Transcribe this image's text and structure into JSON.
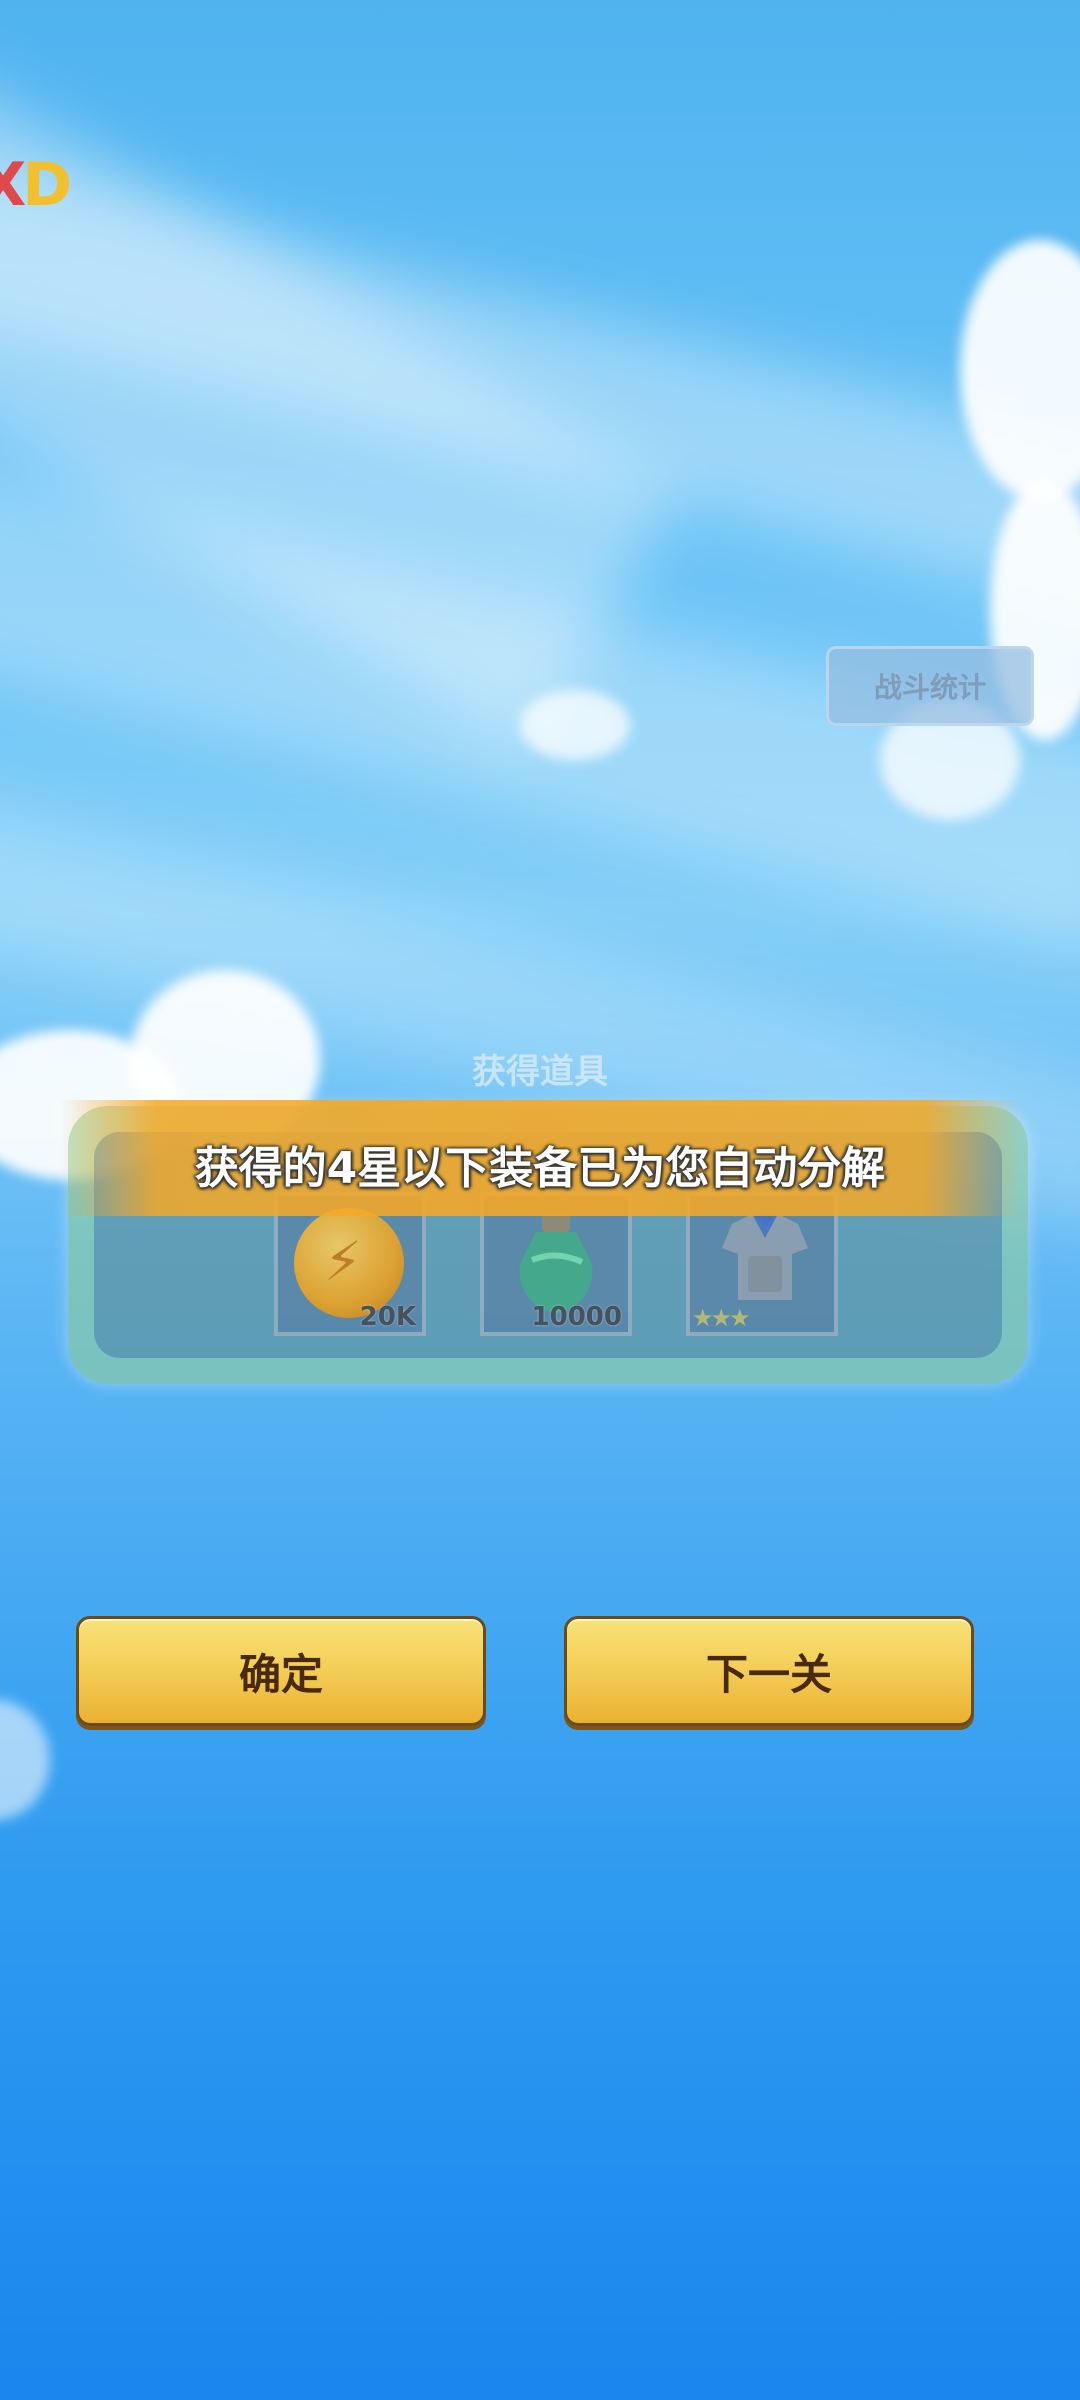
{
  "logo": {
    "text_red": "X",
    "text_yellow": "D"
  },
  "battle_stats_button": "战斗统计",
  "rewards": {
    "title": "获得道具",
    "items": [
      {
        "icon": "coin-icon",
        "amount": "20K"
      },
      {
        "icon": "potion-icon",
        "amount": "10000"
      },
      {
        "icon": "armor-icon",
        "stars": "★★★"
      }
    ]
  },
  "toast": "获得的4星以下装备已为您自动分解",
  "buttons": {
    "confirm": "确定",
    "next_level": "下一关"
  },
  "colors": {
    "sky_top": "#4fb3ef",
    "sky_bottom": "#1a86ee",
    "button_yellow": "#f3cd55",
    "toast_orange": "#f4a828"
  }
}
